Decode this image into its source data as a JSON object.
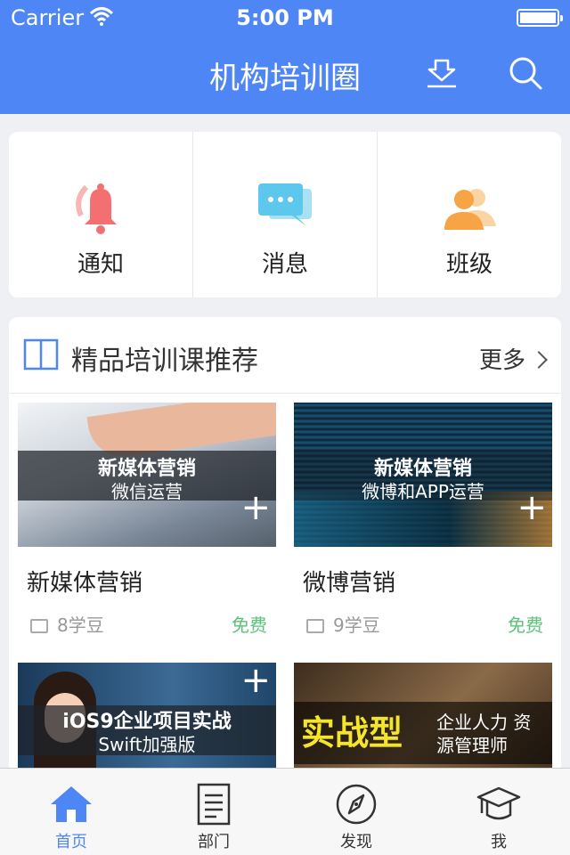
{
  "status": {
    "carrier": "Carrier",
    "time": "5:00 PM"
  },
  "header": {
    "title": "机构培训圈",
    "download_icon": "download-icon",
    "search_icon": "search-icon"
  },
  "quick": [
    {
      "label": "通知",
      "icon": "bell-icon",
      "color": "#f47070"
    },
    {
      "label": "消息",
      "icon": "chat-icon",
      "color": "#5ec7ec"
    },
    {
      "label": "班级",
      "icon": "people-icon",
      "color": "#f6a445"
    }
  ],
  "section": {
    "title": "精品培训课推荐",
    "more": "更多"
  },
  "courses": [
    {
      "title": "新媒体营销",
      "beans": "8学豆",
      "price": "免费",
      "banner": "新媒体营销",
      "subbanner": "微信运营"
    },
    {
      "title": "微博营销",
      "beans": "9学豆",
      "price": "免费",
      "banner": "新媒体营销",
      "subbanner": "微博和APP运营"
    },
    {
      "banner": "iOS9企业项目实战",
      "subbanner": "Swift加强版"
    },
    {
      "banner": "实战型",
      "subbanner": "企业人力 资源管理师"
    }
  ],
  "tabs": [
    {
      "label": "首页",
      "icon": "home-icon"
    },
    {
      "label": "部门",
      "icon": "document-icon"
    },
    {
      "label": "发现",
      "icon": "compass-icon"
    },
    {
      "label": "我",
      "icon": "graduation-cap-icon"
    }
  ],
  "colors": {
    "primary": "#4f86f5",
    "free": "#5cc27a"
  }
}
